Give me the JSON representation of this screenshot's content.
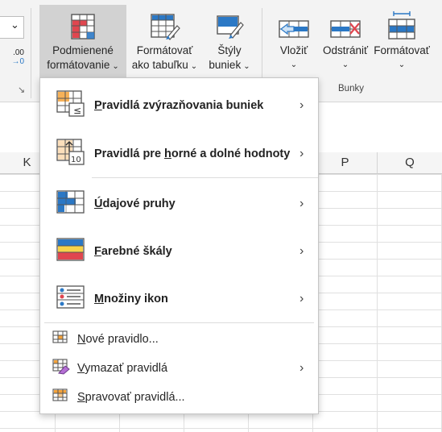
{
  "ribbon": {
    "partial_left": {
      "number_format_arrow": "⌄",
      "decimal_glyph": ".00",
      "decimal_arrow": "→0",
      "launcher": "↘"
    },
    "conditional_formatting": {
      "line1": "Podmienené",
      "line2": "formátovanie"
    },
    "format_as_table": {
      "line1": "Formátovať",
      "line2": "ako tabuľku"
    },
    "cell_styles": {
      "line1": "Štýly",
      "line2": "buniek"
    },
    "insert": {
      "label": "Vložiť"
    },
    "delete": {
      "label": "Odstrániť"
    },
    "format": {
      "label": "Formátovať"
    },
    "cells_group_label": "Bunky",
    "chevron": "⌄"
  },
  "columns": {
    "k": "K",
    "p": "P",
    "q": "Q"
  },
  "menu": {
    "items": [
      {
        "label": "Pravidlá zvýrazňovania buniek",
        "key": "P",
        "rest": "ravidlá zvýrazňovania buniek",
        "icon": "highlight-cells-rules-icon",
        "has_submenu": true
      },
      {
        "label": "Pravidlá pre horné a dolné hodnoty",
        "pre": "Pravidlá pre ",
        "key": "h",
        "rest": "orné a dolné hodnoty",
        "icon": "top-bottom-rules-icon",
        "has_submenu": true
      },
      {
        "label": "Údajové pruhy",
        "key": "Ú",
        "rest": "dajové pruhy",
        "icon": "data-bars-icon",
        "has_submenu": true
      },
      {
        "label": "Farebné škály",
        "key": "F",
        "rest": "arebné škály",
        "icon": "color-scales-icon",
        "has_submenu": true
      },
      {
        "label": "Množiny ikon",
        "key": "M",
        "rest": "nožiny ikon",
        "icon": "icon-sets-icon",
        "has_submenu": true
      }
    ],
    "commands": [
      {
        "label": "Nové pravidlo...",
        "key": "N",
        "rest": "ové pravidlo...",
        "icon": "new-rule-icon",
        "has_submenu": false
      },
      {
        "label": "Vymazať pravidlá",
        "key": "V",
        "rest": "ymazať pravidlá",
        "icon": "clear-rules-icon",
        "has_submenu": true
      },
      {
        "label": "Spravovať pravidlá...",
        "key": "S",
        "rest": "pravovať pravidlá...",
        "icon": "manage-rules-icon",
        "has_submenu": false
      }
    ],
    "submenu_arrow": "›"
  },
  "colors": {
    "accent_blue": "#2b78c5",
    "accent_red": "#e0464f",
    "accent_orange": "#f5a33b",
    "hover_bg": "#d2d2d2"
  }
}
